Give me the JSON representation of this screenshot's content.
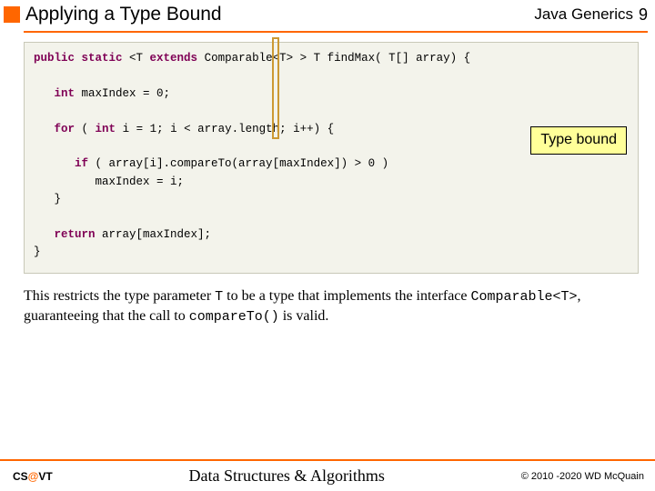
{
  "header": {
    "title_left": "Applying a Type Bound",
    "title_right": "Java Generics",
    "page_number": "9"
  },
  "code": {
    "line1a": "public ",
    "line1b": "static ",
    "line1c": "<T ",
    "line1d": "extends ",
    "line1e": "Comparable<T> > T findMax( T[]  array) {",
    "line2a": "int ",
    "line2b": "maxIndex = 0;",
    "line3a": "for ",
    "line3b": "( ",
    "line3c": "int ",
    "line3d": "i = 1; i < array.length; i++) {",
    "line4a": "if ",
    "line4b": "( array[i].compareTo(array[maxIndex]) > 0 )",
    "line5": "maxIndex = i;",
    "line6": "}",
    "line7a": "return ",
    "line7b": "array[maxIndex];",
    "line8": "}"
  },
  "callout": {
    "label": "Type bound"
  },
  "body": {
    "t1": "This restricts the type parameter ",
    "t2": "T",
    "t3": " to be a type that implements the interface ",
    "t4": "Comparable<T>",
    "t5": ", guaranteeing that the call to ",
    "t6": "compareTo()",
    "t7": " is valid."
  },
  "footer": {
    "left_cs": "CS",
    "left_at": "@",
    "left_vt": "VT",
    "center": "Data Structures & Algorithms",
    "right": "© 2010 -2020 WD McQuain"
  }
}
